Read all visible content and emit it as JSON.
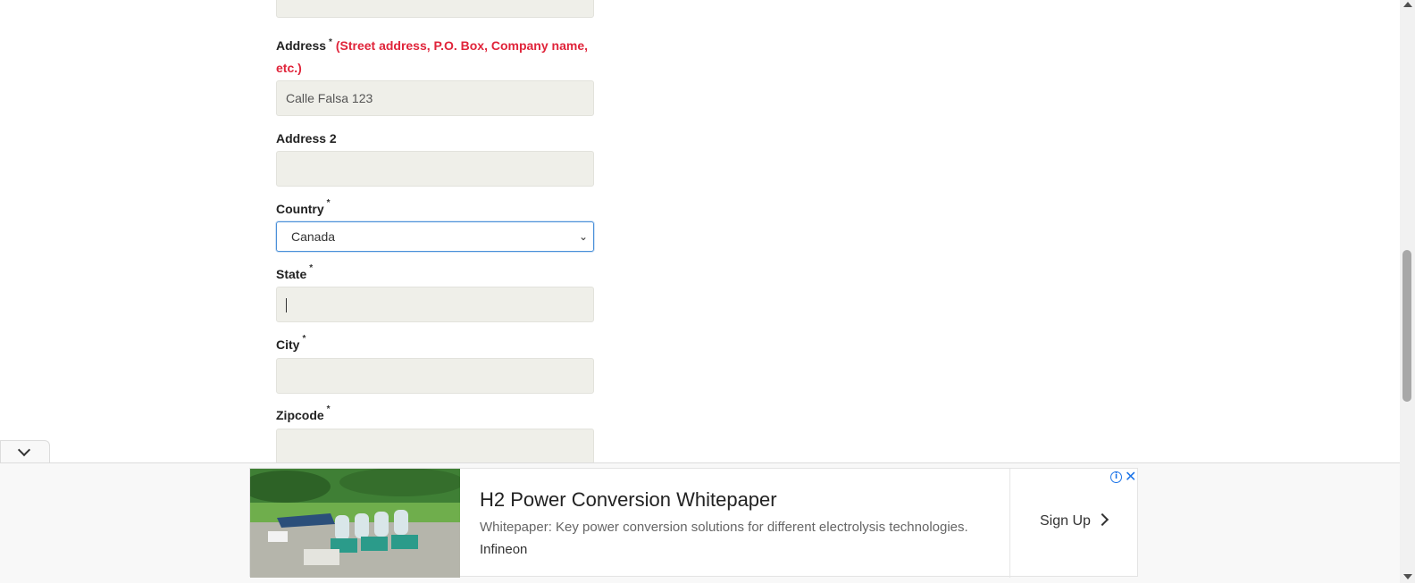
{
  "form": {
    "address_label": "Address",
    "address_hint": "(Street address, P.O. Box, Company name, etc.)",
    "address_value": "Calle Falsa 123",
    "address2_label": "Address 2",
    "address2_value": "",
    "country_label": "Country",
    "country_value": "Canada",
    "state_label": "State",
    "state_value": "",
    "city_label": "City",
    "city_value": "",
    "zipcode_label": "Zipcode",
    "zipcode_value": "",
    "required_marker": "*"
  },
  "ad": {
    "title": "H2 Power Conversion Whitepaper",
    "description": "Whitepaper: Key power conversion solutions for different electrolysis technologies.",
    "brand": "Infineon",
    "cta": "Sign Up",
    "info_icon": "info-icon",
    "close_icon": "close-icon"
  },
  "colors": {
    "hint": "#e0243a",
    "input_bg": "#efefe9",
    "focus_border": "#4a90d9",
    "ad_icons": "#1a73e8"
  }
}
